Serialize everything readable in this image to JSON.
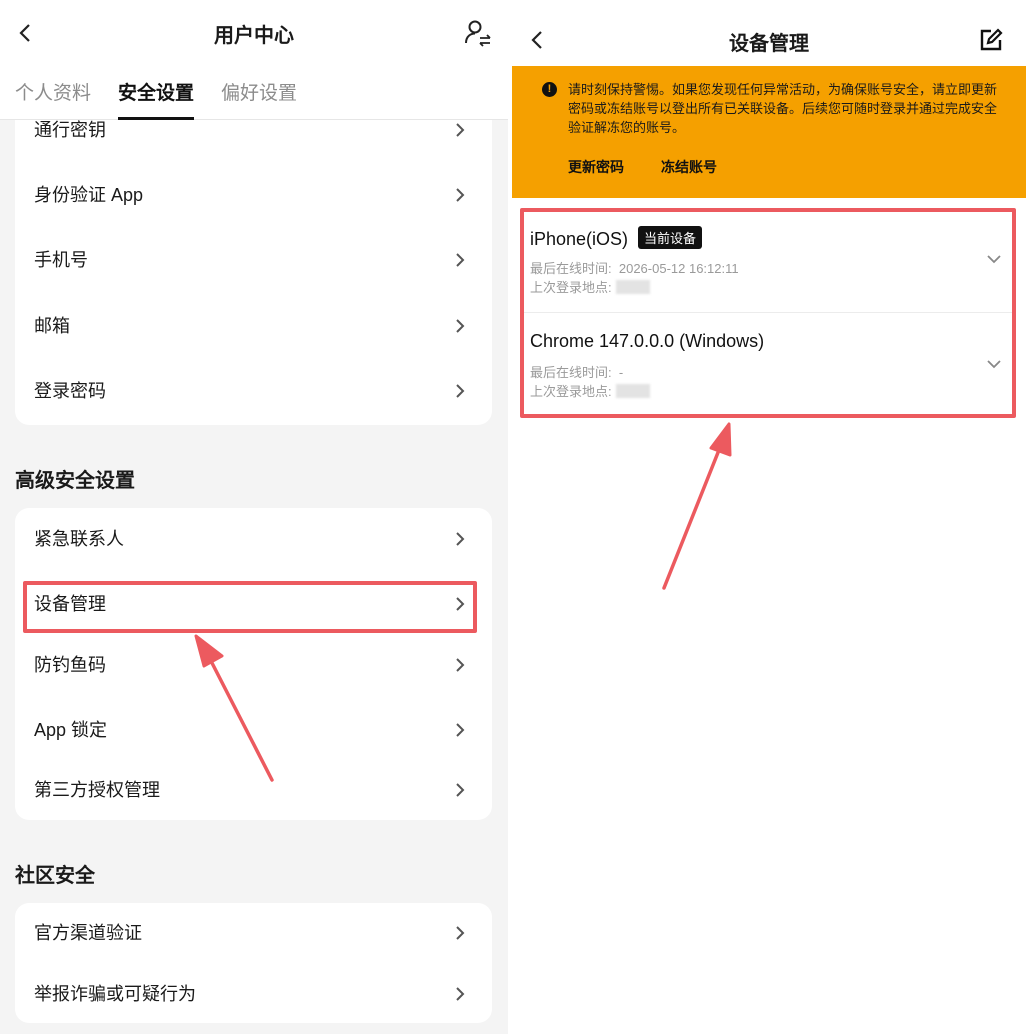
{
  "left": {
    "title": "用户中心",
    "tabs": [
      {
        "label": "个人资料",
        "active": false
      },
      {
        "label": "安全设置",
        "active": true
      },
      {
        "label": "偏好设置",
        "active": false
      }
    ],
    "basic_items": [
      "通行密钥",
      "身份验证 App",
      "手机号",
      "邮箱",
      "登录密码"
    ],
    "advanced_title": "高级安全设置",
    "advanced_items": [
      "紧急联系人",
      "设备管理",
      "防钓鱼码",
      "App 锁定",
      "第三方授权管理"
    ],
    "community_title": "社区安全",
    "community_items": [
      "官方渠道验证",
      "举报诈骗或可疑行为"
    ]
  },
  "right": {
    "title": "设备管理",
    "banner": {
      "text": "请时刻保持警惕。如果您发现任何异常活动，为确保账号安全，请立即更新密码或冻结账号以登出所有已关联设备。后续您可随时登录并通过完成安全验证解冻您的账号。",
      "update_password": "更新密码",
      "freeze_account": "冻结账号"
    },
    "devices": [
      {
        "name": "iPhone(iOS)",
        "badge": "当前设备",
        "last_online_label": "最后在线时间:",
        "last_online_value": "2026-05-12 16:12:11",
        "location_label": "上次登录地点:"
      },
      {
        "name": "Chrome 147.0.0.0 (Windows)",
        "last_online_label": "最后在线时间:",
        "last_online_value": "-",
        "location_label": "上次登录地点:"
      }
    ]
  },
  "colors": {
    "highlight": "#ec5a5f",
    "banner": "#f5a000",
    "page_bg": "#f4f4f4"
  },
  "icons": [
    "back-icon",
    "user-switch-icon",
    "chevron-right-icon",
    "edit-icon",
    "warning-icon",
    "chevron-down-icon"
  ]
}
